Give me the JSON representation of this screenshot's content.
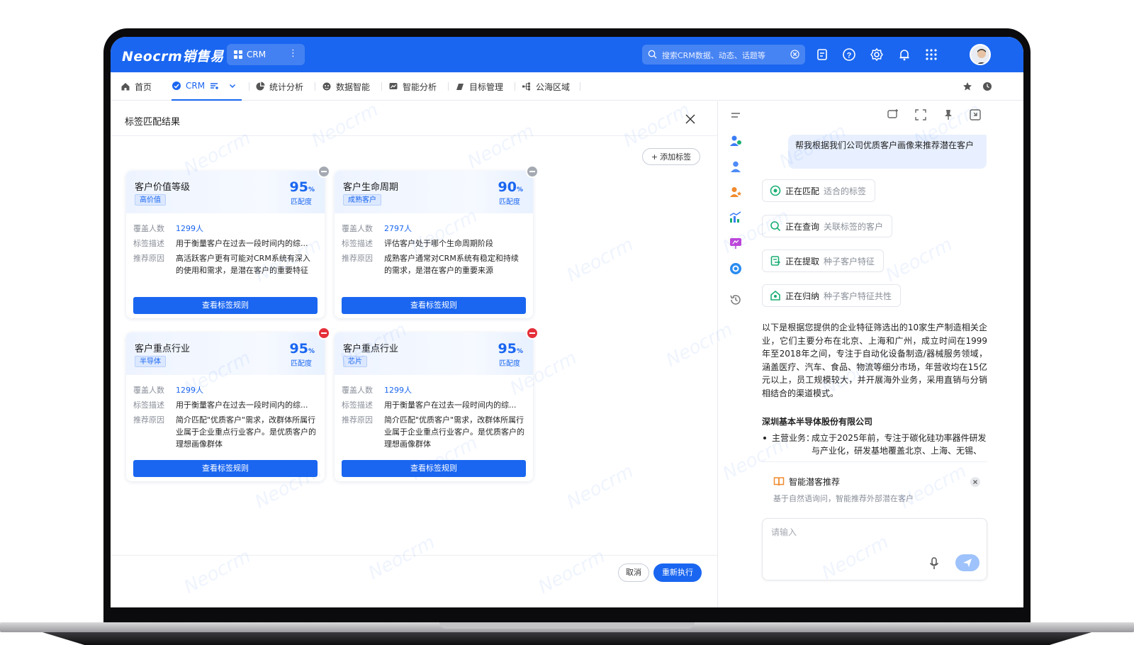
{
  "app": {
    "logo": "Neocrm销售易",
    "app_switch_label": "CRM"
  },
  "search": {
    "placeholder": "搜索CRM数据、动态、话题等"
  },
  "nav": {
    "items": [
      "首页",
      "CRM",
      "统计分析",
      "数据智能",
      "智能分析",
      "目标管理",
      "公海区域"
    ]
  },
  "panel": {
    "title": "标签匹配结果",
    "add_tag_label": "添加标签",
    "field_labels": {
      "coverage": "覆盖人数",
      "desc": "标签描述",
      "reason": "推荐原因"
    },
    "match_label": "匹配度",
    "view_rule_label": "查看标签规则",
    "cancel_label": "取消",
    "rerun_label": "重新执行",
    "cards": [
      {
        "name": "客户价值等级",
        "badge": "高价值",
        "percent": "95",
        "coverage": "1299人",
        "desc": "用于衡量客户在过去一段时间内的综...",
        "reason": "高活跃客户更有可能对CRM系统有深入的使用和需求，是潜在客户的重要特征",
        "corner": "gray"
      },
      {
        "name": "客户生命周期",
        "badge": "成熟客户",
        "percent": "90",
        "coverage": "2797人",
        "desc": "评估客户处于哪个生命周期阶段",
        "reason": "成熟客户通常对CRM系统有稳定和持续的需求，是潜在客户的重要来源",
        "corner": "gray"
      },
      {
        "name": "客户重点行业",
        "badge": "半导体",
        "percent": "95",
        "coverage": "1299人",
        "desc": "用于衡量客户在过去一段时间内的综...",
        "reason": "简介匹配\"优质客户\"需求，改群体所属行业属于企业重点行业客户。是优质客户的理想画像群体",
        "corner": "red"
      },
      {
        "name": "客户重点行业",
        "badge": "芯片",
        "percent": "95",
        "coverage": "1299人",
        "desc": "用于衡量客户在过去一段时间内的综...",
        "reason": "简介匹配\"优质客户\"需求，改群体所属行业属于企业重点行业客户。是优质客户的理想画像群体",
        "corner": "red"
      }
    ]
  },
  "assistant": {
    "user_message": "帮我根据我们公司优质客户画像来推荐潜在客户",
    "steps": [
      {
        "action": "正在匹配",
        "target": "适合的标签",
        "icon": "target-icon",
        "color": "#1aae74"
      },
      {
        "action": "正在查询",
        "target": "关联标签的客户",
        "icon": "search-icon",
        "color": "#1aae74"
      },
      {
        "action": "正在提取",
        "target": "种子客户特征",
        "icon": "extract-icon",
        "color": "#1aae74"
      },
      {
        "action": "正在归纳",
        "target": "种子客户特征共性",
        "icon": "summarize-icon",
        "color": "#1aae74"
      }
    ],
    "answer": "以下是根据您提供的企业特征筛选出的10家生产制造相关企业，它们主要分布在北京、上海和广州，成立时间在1999年至2018年之间，专注于自动化设备制造/器械服务领域，涵盖医疗、汽车、食品、物流等细分市场，年营收均在15亿元以上，员工规模较大，并开展海外业务，采用直销与分销相结合的渠道模式。",
    "company": "深圳基本半导体股份有限公司",
    "bullet_label": "主营业务：",
    "bullet_text": "成立于2025年前，专注于碳化硅功率器件研发与产业化，研发基地覆盖北京、上海、无锡、香港和日本名古屋",
    "recommend_title": "智能潜客推荐",
    "recommend_desc": "基于自然语询问，智能推荐外部潜在客户",
    "input_placeholder": "请输入"
  },
  "watermark": "Neocrm",
  "colors": {
    "brand": "#1a66f0",
    "danger": "#e5303a",
    "success": "#1aae74"
  }
}
